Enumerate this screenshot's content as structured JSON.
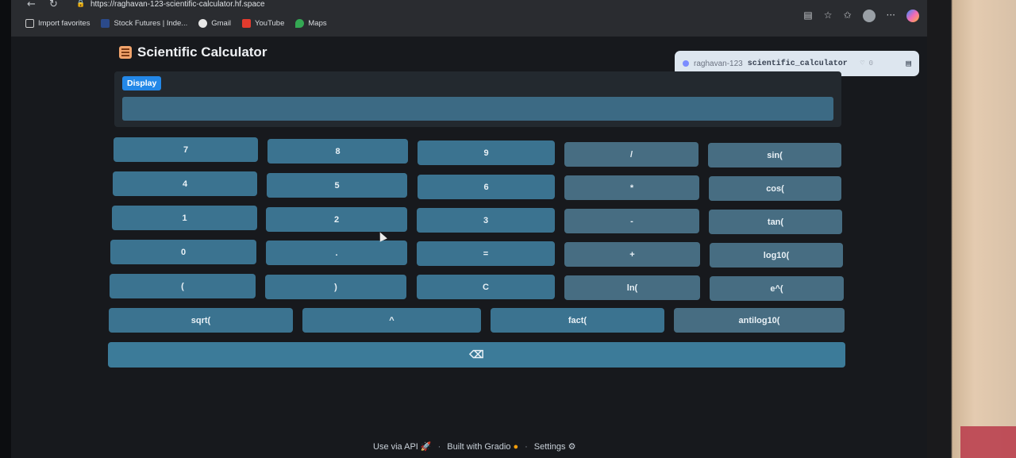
{
  "browser": {
    "url": "https://raghavan-123-scientific-calculator.hf.space",
    "bookmarks": [
      "Import favorites",
      "Stock Futures | Inde...",
      "Gmail",
      "YouTube",
      "Maps"
    ]
  },
  "app": {
    "title": "Scientific Calculator"
  },
  "hf_badge": {
    "owner": "raghavan-123",
    "space": "scientific_calculator",
    "likes": "0"
  },
  "display": {
    "label": "Display",
    "value": ""
  },
  "buttons": [
    "7",
    "8",
    "9",
    "/",
    "sin(",
    "4",
    "5",
    "6",
    "*",
    "cos(",
    "1",
    "2",
    "3",
    "-",
    "tan(",
    "0",
    ".",
    "=",
    "+",
    "log10(",
    "(",
    ")",
    "C",
    "ln(",
    "e^(",
    "sqrt(",
    "^",
    "fact(",
    "antilog10(",
    "⌫"
  ],
  "footer": {
    "api": "Use via API",
    "built": "Built with Gradio",
    "settings": "Settings"
  },
  "colors": {
    "button": "#3b7390",
    "display_label": "#2388e8",
    "background": "#17191d"
  }
}
